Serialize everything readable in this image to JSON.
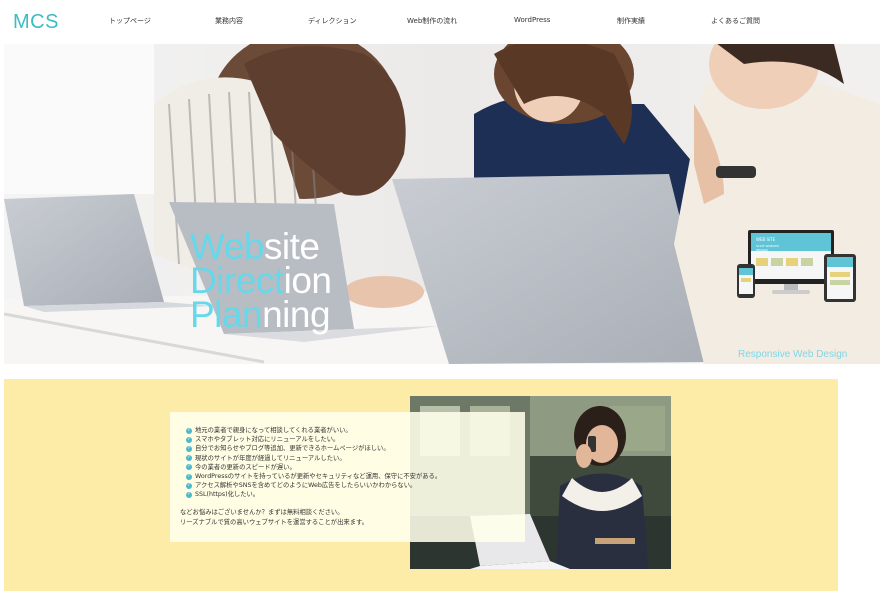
{
  "header": {
    "logo": "MCS",
    "nav": [
      {
        "label": "トップページ"
      },
      {
        "label": "業務内容"
      },
      {
        "label": "ディレクション"
      },
      {
        "label": "Web制作の流れ"
      },
      {
        "label": "WordPress"
      },
      {
        "label": "制作実績"
      },
      {
        "label": "よくあるご質問"
      }
    ]
  },
  "hero": {
    "lines": [
      {
        "highlight": "Web",
        "rest": "site"
      },
      {
        "highlight": "Direct",
        "rest": "ion"
      },
      {
        "highlight": "Plan",
        "rest": "ning"
      }
    ],
    "responsive_caption": "Responsive Web Design",
    "device_mock_text": {
      "title": "WEB SITE",
      "line1": "SLICE WINDOW",
      "line2": "DESIGN"
    }
  },
  "intro": {
    "items": [
      "地元の業者で親身になって相談してくれる業者がいい。",
      "スマホやタブレット対応にリニューアルをしたい。",
      "自分でお知らせやブログ等追加、更新できるホームページがほしい。",
      "現状のサイトが年度が経過してリニューアルしたい。",
      "今の業者の更新のスピードが遅い。",
      "WordPressのサイトを持っているが更新やセキュリティなど運用、保守に不安がある。",
      "アクセス解析やSNSを含めてどのようにWeb広告をしたらいいかわからない。",
      "SSL(https)化したい。"
    ],
    "closing": [
      "などお悩みはございませんか？まずは無料相談ください。",
      "リーズナブルで質の高いウェブサイトを運営することが出来ます。"
    ]
  },
  "colors": {
    "accent": "#3cbcc4",
    "highlight": "#66d8ec",
    "section_bg": "#fdeba8"
  }
}
